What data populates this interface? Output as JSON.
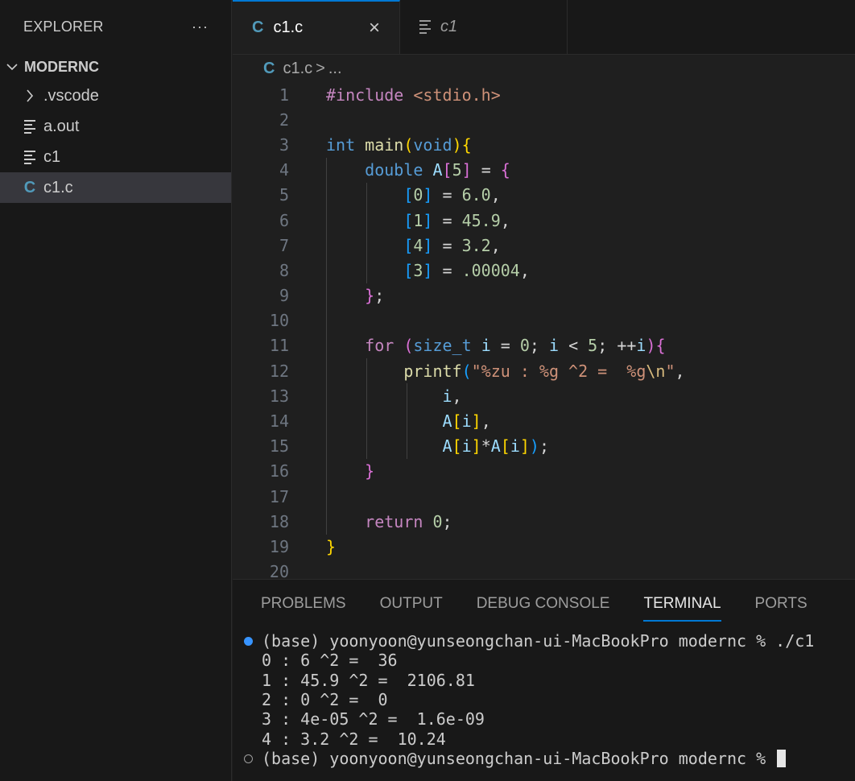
{
  "explorer": {
    "title": "EXPLORER",
    "more": "···",
    "root": "MODERNC",
    "items": [
      {
        "label": ".vscode",
        "icon": "chevron-right-icon"
      },
      {
        "label": "a.out",
        "icon": "lines-icon"
      },
      {
        "label": "c1",
        "icon": "lines-icon"
      },
      {
        "label": "c1.c",
        "icon": "c-file-icon",
        "selected": true
      }
    ]
  },
  "tabs": [
    {
      "label": "c1.c",
      "icon": "C",
      "active": true,
      "close": "×"
    },
    {
      "label": "c1",
      "icon": "lines-icon",
      "active": false
    }
  ],
  "breadcrumb": {
    "icon": "C",
    "file": "c1.c",
    "sep": ">",
    "rest": "..."
  },
  "code": {
    "line_numbers": [
      "1",
      "2",
      "3",
      "4",
      "5",
      "6",
      "7",
      "8",
      "9",
      "10",
      "11",
      "12",
      "13",
      "14",
      "15",
      "16",
      "17",
      "18",
      "19",
      "20"
    ],
    "l1_pre": "#include",
    "l1_hdr": "<stdio.h>",
    "l3_int": "int",
    "l3_main": "main",
    "l3_void": "void",
    "l4_double": "double",
    "l4_A": "A",
    "l4_5": "5",
    "l4_eq": " = ",
    "l5_idx": "0",
    "l5_val": "6.0",
    "l6_idx": "1",
    "l6_val": "45.9",
    "l7_idx": "4",
    "l7_val": "3.2",
    "l8_idx": "3",
    "l8_val": ".00004",
    "l11_for": "for",
    "l11_sizet": "size_t",
    "l11_i": "i",
    "l11_zero": "0",
    "l11_five": "5",
    "l11_inc": "++",
    "l12_printf": "printf",
    "l12_s1": "\"%zu : %g ^2 =  %g",
    "l12_esc": "\\n",
    "l12_s2": "\"",
    "l13_i": "i",
    "l14_A": "A",
    "l14_i": "i",
    "l15_A1": "A",
    "l15_i1": "i",
    "l15_A2": "A",
    "l15_i2": "i",
    "l18_return": "return",
    "l18_zero": "0"
  },
  "panel": {
    "tabs": [
      "PROBLEMS",
      "OUTPUT",
      "DEBUG CONSOLE",
      "TERMINAL",
      "PORTS"
    ],
    "active_tab": "TERMINAL",
    "terminal_lines": [
      "(base) yoonyoon@yunseongchan-ui-MacBookPro modernc % ./c1",
      "0 : 6 ^2 =  36",
      "1 : 45.9 ^2 =  2106.81",
      "2 : 0 ^2 =  0",
      "3 : 4e-05 ^2 =  1.6e-09",
      "4 : 3.2 ^2 =  10.24",
      "(base) yoonyoon@yunseongchan-ui-MacBookPro modernc % "
    ]
  },
  "colors": {
    "accent": "#0078d4",
    "c_icon": "#519aba",
    "status_dot": "#3794ff"
  }
}
